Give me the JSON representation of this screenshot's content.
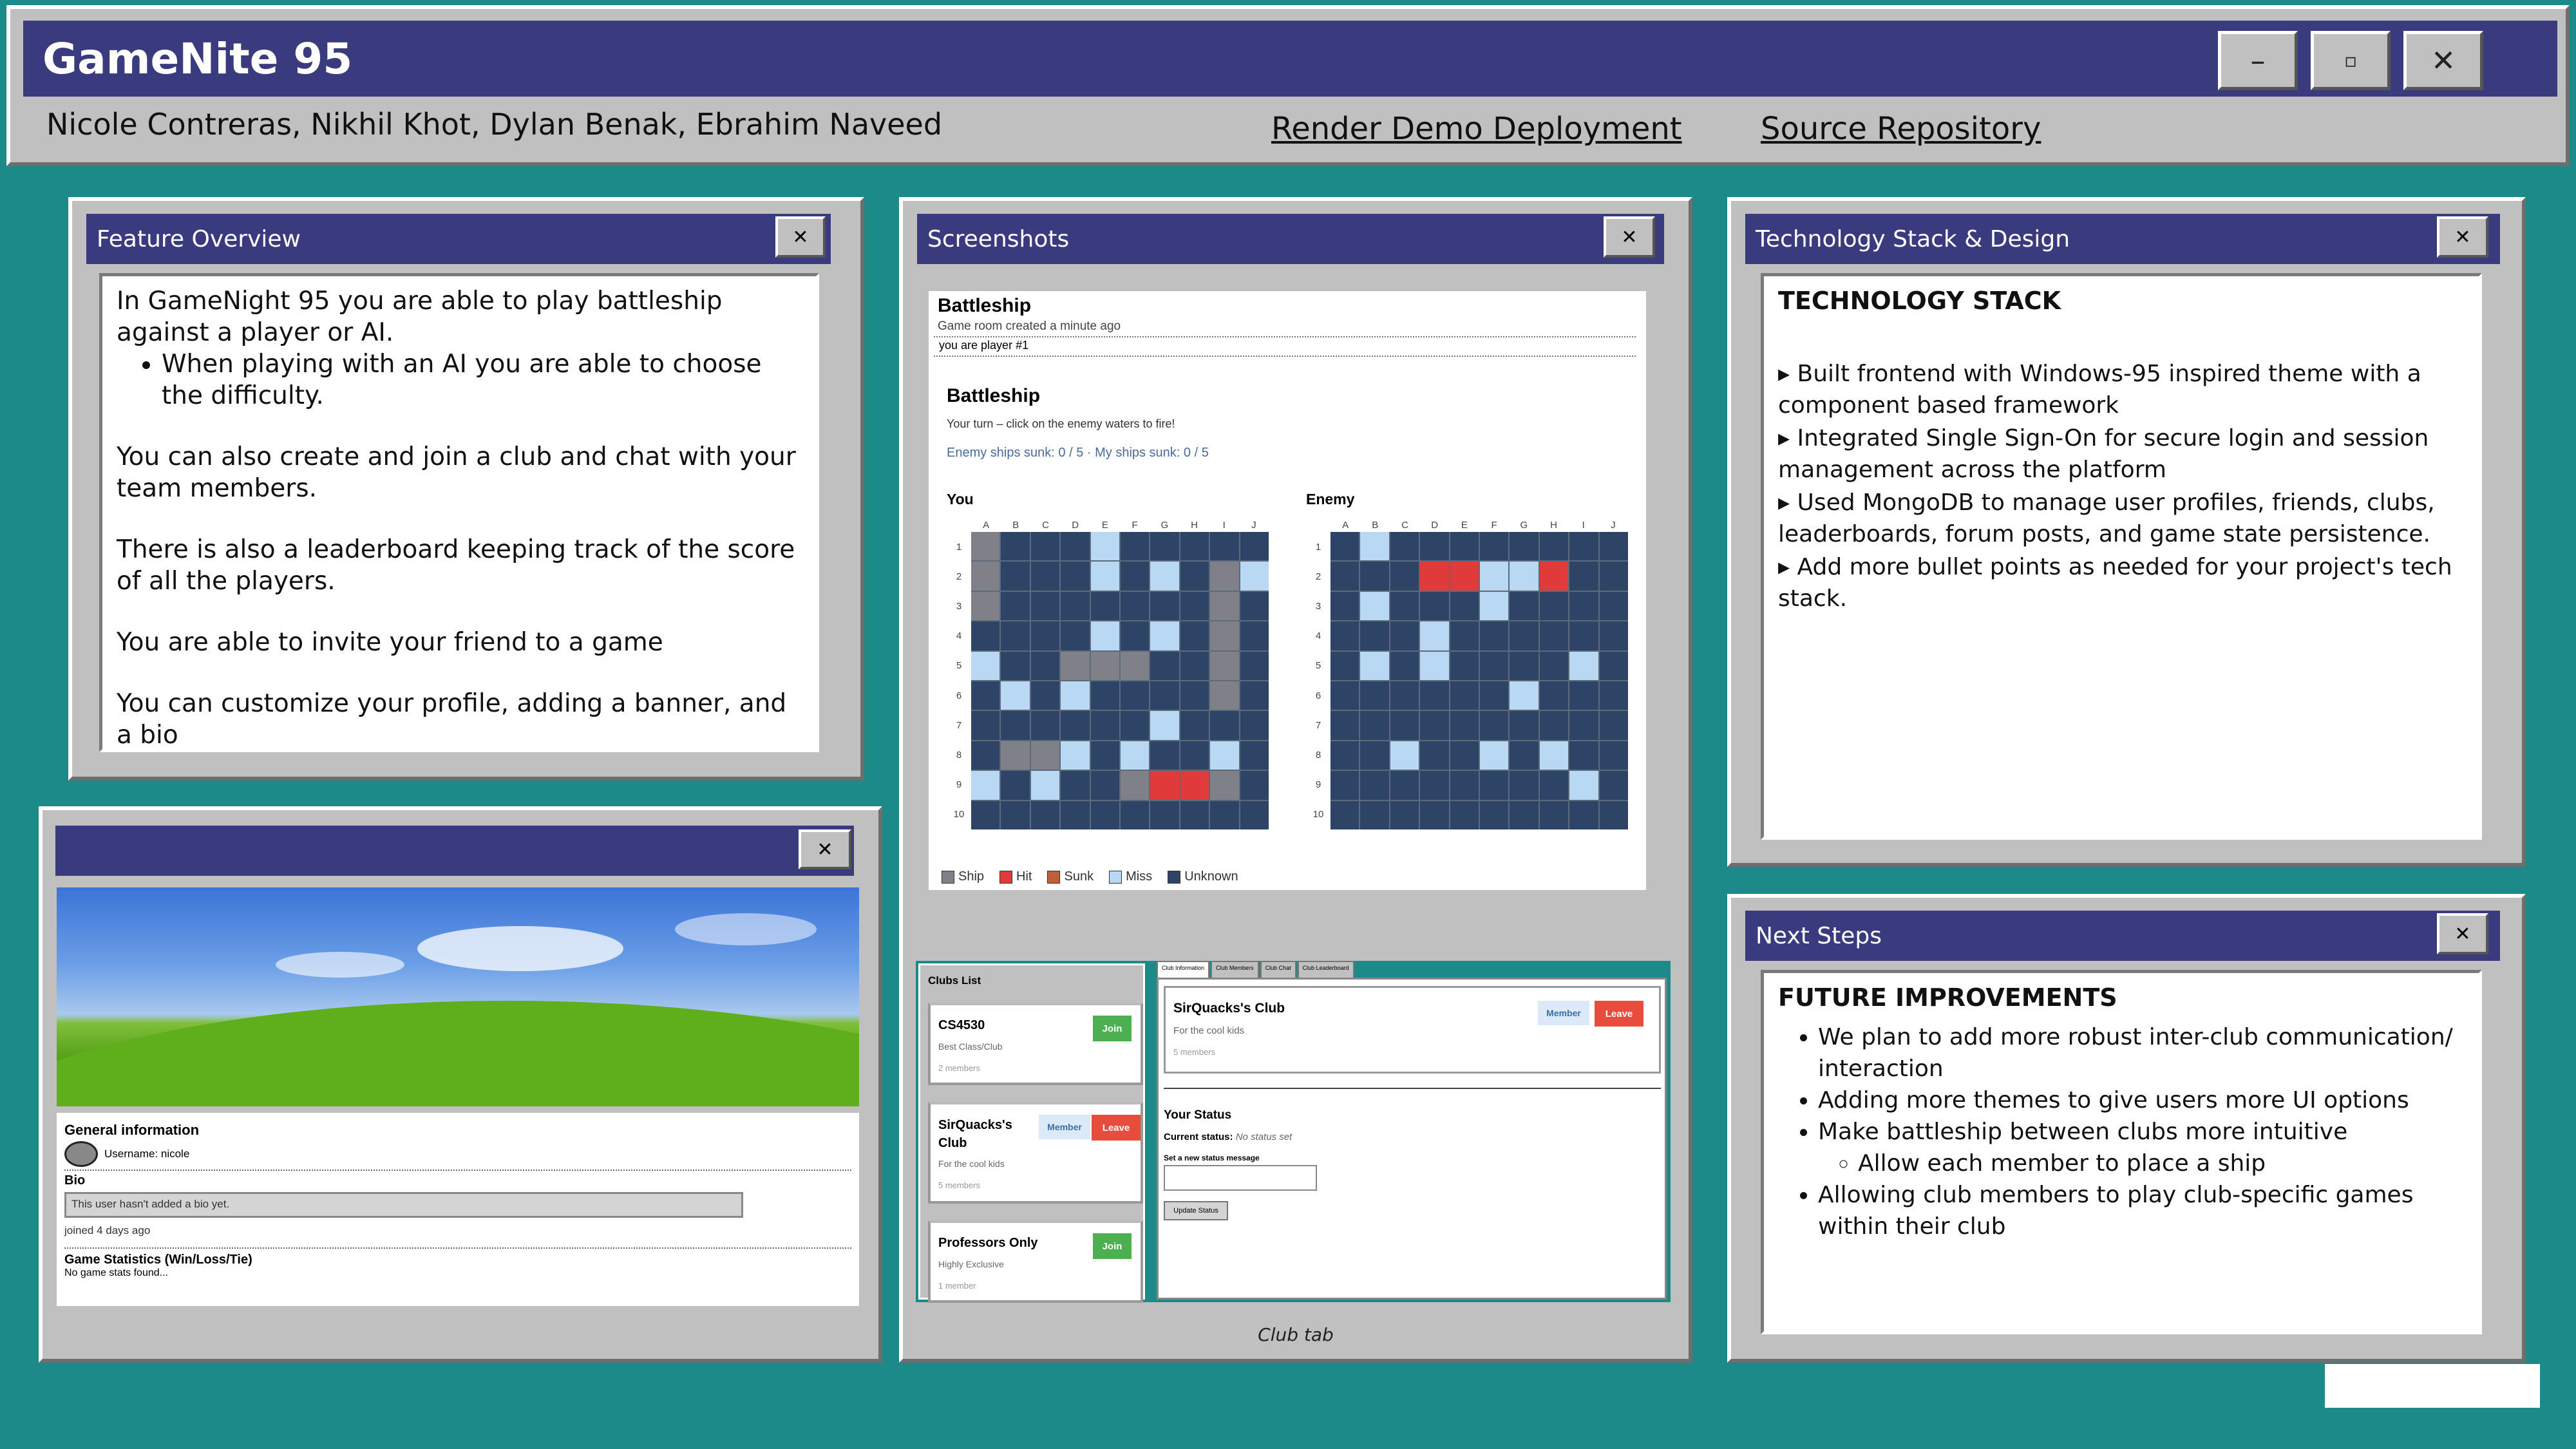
{
  "app": {
    "title": "GameNite 95",
    "authors": "Nicole Contreras, Nikhil Khot, Dylan Benak, Ebrahim Naveed",
    "links": {
      "demo": "Render Demo Deployment",
      "repo": "Source Repository"
    },
    "controls": {
      "minimize": "–",
      "maximize": "▫",
      "close": "✕"
    }
  },
  "close_glyph": "✕",
  "feature": {
    "title": "Feature Overview",
    "p1": "In GameNight 95 you are able to play battleship against a player or AI.",
    "b1": "When playing with an AI you are able to choose the difficulty.",
    "p2": "You can also create and join a club and chat with your team members.",
    "p3": "There is also a leaderboard keeping track of the score of all the players.",
    "p4": "You are able to invite your friend to a game",
    "p5": "You can customize your profile, adding a banner, and a bio"
  },
  "profile": {
    "general": "General information",
    "username": "Username: nicole",
    "bio_label": "Bio",
    "bio_value": "This user hasn't added a bio yet.",
    "joined": "joined 4 days ago",
    "stats": "Game Statistics (Win/Loss/Tie)",
    "no_stats": "No game stats found..."
  },
  "screenshots": {
    "title": "Screenshots",
    "battleship": {
      "room_title": "Battleship",
      "room_created": "Game room created a minute ago",
      "player": "you are player #1",
      "heading": "Battleship",
      "turn": "Your turn – click on the enemy waters to fire!",
      "sunk": "Enemy ships sunk: 0 / 5 · My ships sunk: 0 / 5",
      "you": "You",
      "enemy": "Enemy",
      "cols": [
        "A",
        "B",
        "C",
        "D",
        "E",
        "F",
        "G",
        "H",
        "I",
        "J"
      ],
      "rows": [
        "1",
        "2",
        "3",
        "4",
        "5",
        "6",
        "7",
        "8",
        "9",
        "10"
      ],
      "legend": {
        "ship": "Ship",
        "hit": "Hit",
        "sunk": "Sunk",
        "miss": "Miss",
        "unknown": "Unknown"
      },
      "colors": {
        "ship": "#808088",
        "hit": "#e03a3a",
        "sunk": "#c0603a",
        "miss": "#b8d8f4",
        "unknown": "#2e4466"
      }
    },
    "clubs": {
      "list_title": "Clubs List",
      "cards": [
        {
          "name": "CS4530",
          "desc": "Best Class/Club",
          "members": "2 members",
          "action": "Join"
        },
        {
          "name": "SirQuacks's Club",
          "desc": "For the cool kids",
          "members": "5 members",
          "badge": "Member",
          "action": "Leave"
        },
        {
          "name": "Professors Only",
          "desc": "Highly Exclusive",
          "members": "1 member",
          "action": "Join"
        }
      ],
      "tabs": [
        "Club Information",
        "Club Members",
        "Club Chat",
        "Club Leaderboard"
      ],
      "detail": {
        "name": "SirQuacks's Club",
        "desc": "For the cool kids",
        "members": "5 members",
        "badge": "Member",
        "action": "Leave",
        "status_title": "Your Status",
        "current_label": "Current status:",
        "current_value": "No status set",
        "new_label": "Set a new status message",
        "update": "Update Status"
      }
    },
    "caption": "Club tab"
  },
  "tech": {
    "title": "Technology Stack & Design",
    "heading": "TECHNOLOGY STACK",
    "items": [
      "▸ Built frontend with Windows-95 inspired theme with a component based framework",
      "▸ Integrated Single Sign-On for secure login and session management across the platform",
      "▸ Used MongoDB to manage user profiles, friends, clubs, leaderboards, forum posts, and game state persistence.",
      "▸ Add more bullet points as needed for your project's tech stack."
    ]
  },
  "next": {
    "title": "Next Steps",
    "heading": "FUTURE IMPROVEMENTS",
    "items": [
      "We plan to add more robust inter-club communication/ interaction",
      "Adding more themes to give users more UI options",
      "Make battleship between clubs more intuitive"
    ],
    "sub_item": "Allow each member to place a ship",
    "last_item": "Allowing club members to play club-specific games within their club"
  }
}
